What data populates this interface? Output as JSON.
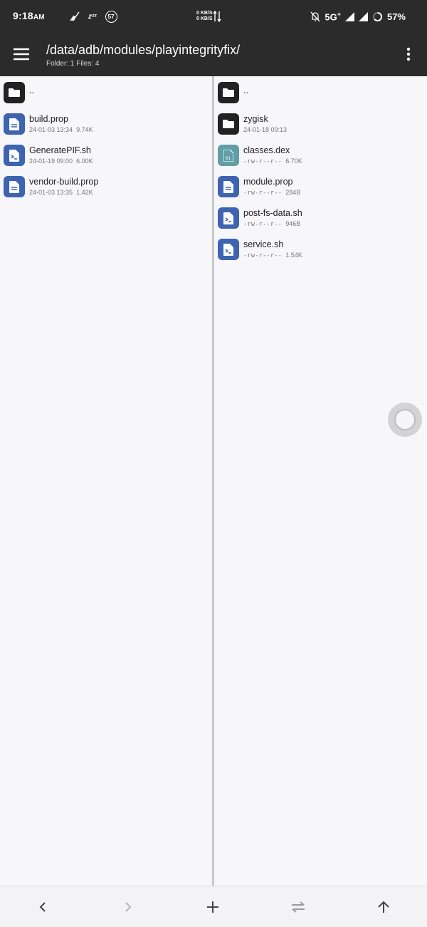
{
  "status_bar": {
    "time": "9:18",
    "ampm": "AM",
    "zzz": "zᶻᶻ",
    "badge_count": "57",
    "speed_up": "0 KB/S",
    "speed_down": "0 KB/S",
    "network": "5G",
    "network_plus": "+",
    "battery": "57%",
    "icons": [
      "broom-icon",
      "sleep-icon",
      "notification-count-badge",
      "data-transfer-icon",
      "mute-bell-icon",
      "signal-icon",
      "signal-icon",
      "battery-ring-icon"
    ]
  },
  "app_bar": {
    "path": "/data/adb/modules/playintegrityfix/",
    "summary": "Folder: 1  Files: 4",
    "icons": [
      "menu-icon",
      "more-vert-icon"
    ]
  },
  "left_pane": {
    "items": [
      {
        "name": "..",
        "type": "folder"
      },
      {
        "name": "build.prop",
        "date": "24-01-03 13:34",
        "size": "9.74K",
        "type": "doc"
      },
      {
        "name": "GeneratePIF.sh",
        "date": "24-01-19 09:00",
        "size": "6.00K",
        "type": "script"
      },
      {
        "name": "vendor-build.prop",
        "date": "24-01-03 13:35",
        "size": "1.42K",
        "type": "doc"
      }
    ]
  },
  "right_pane": {
    "items": [
      {
        "name": "..",
        "type": "folder"
      },
      {
        "name": "zygisk",
        "date": "24-01-18 09:13",
        "type": "folder"
      },
      {
        "name": "classes.dex",
        "perms": "-rw-r--r--",
        "size": "6.70K",
        "type": "binary"
      },
      {
        "name": "module.prop",
        "perms": "-rw-r--r--",
        "size": "284B",
        "type": "doc"
      },
      {
        "name": "post-fs-data.sh",
        "perms": "-rw-r--r--",
        "size": "946B",
        "type": "script"
      },
      {
        "name": "service.sh",
        "perms": "-rw-r--r--",
        "size": "1.54K",
        "type": "script"
      }
    ]
  },
  "bottom_bar": {
    "buttons": [
      "back-icon",
      "forward-icon",
      "add-icon",
      "swap-icon",
      "up-icon"
    ]
  },
  "colors": {
    "app_bar": "#2b2b2b",
    "folder_icon": "#222222",
    "doc_icon": "#3b63b8",
    "dex_icon": "#5f9ea5"
  }
}
